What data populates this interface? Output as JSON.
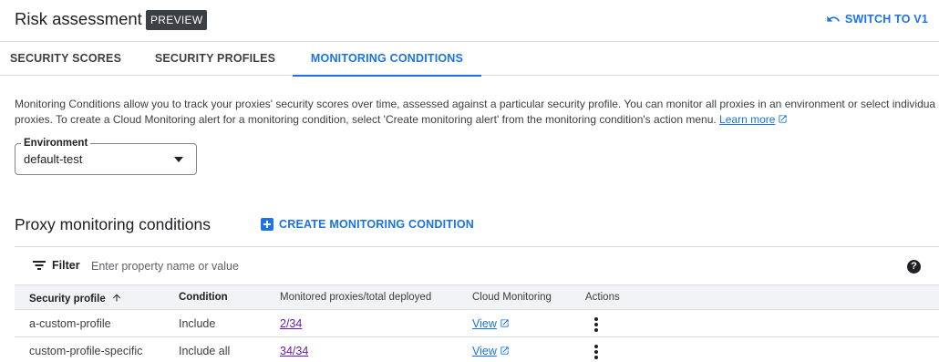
{
  "header": {
    "title": "Risk assessment",
    "badge": "PREVIEW",
    "switch_label": "SWITCH TO V1"
  },
  "tabs": [
    {
      "label": "SECURITY SCORES",
      "active": false
    },
    {
      "label": "SECURITY PROFILES",
      "active": false
    },
    {
      "label": "MONITORING CONDITIONS",
      "active": true
    }
  ],
  "description": {
    "line1": "Monitoring Conditions allow you to track your proxies' security scores over time, assessed against a particular security profile. You can monitor all proxies in an environment or select individual",
    "line2": "proxies. To create a Cloud Monitoring alert for a monitoring condition, select 'Create monitoring alert' from the monitoring condition's action menu. ",
    "learn_more": "Learn more"
  },
  "environment": {
    "label": "Environment",
    "value": "default-test"
  },
  "section": {
    "title": "Proxy monitoring conditions",
    "create_label": "CREATE MONITORING CONDITION"
  },
  "filter": {
    "label": "Filter",
    "placeholder": "Enter property name or value"
  },
  "table": {
    "columns": [
      "Security profile",
      "Condition",
      "Monitored proxies/total deployed",
      "Cloud Monitoring",
      "Actions"
    ],
    "rows": [
      {
        "profile": "a-custom-profile",
        "condition": "Include",
        "proxies": "2/34",
        "monitoring": "View"
      },
      {
        "profile": "custom-profile-specific",
        "condition": "Include all",
        "proxies": "34/34",
        "monitoring": "View"
      }
    ]
  },
  "colors": {
    "accent": "#1a73e8",
    "visited_link": "#681da8",
    "badge_bg": "#3c4043",
    "header_row_bg": "#f1f3f4"
  }
}
